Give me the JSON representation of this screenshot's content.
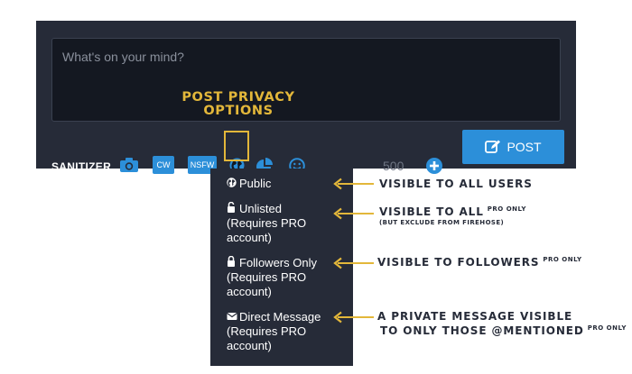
{
  "composer": {
    "placeholder": "What's on your mind?",
    "sanitizer_label": "SANITIZER",
    "tools": {
      "camera_icon": "camera-icon",
      "cw_label": "CW",
      "nsfw_label": "NSFW",
      "globe_icon": "globe-icon",
      "poll_icon": "pie-chart-icon",
      "emoji_icon": "smiley-icon"
    },
    "char_counter": "500",
    "add_icon": "plus-circle-icon",
    "post_label": "POST"
  },
  "annotation_title": [
    "POST PRIVACY",
    "OPTIONS"
  ],
  "privacy_menu": [
    {
      "icon": "globe-icon",
      "lines": [
        "Public"
      ]
    },
    {
      "icon": "unlock-icon",
      "lines": [
        "Unlisted",
        "(Requires PRO",
        "account)"
      ]
    },
    {
      "icon": "lock-icon",
      "lines": [
        "Followers Only",
        "(Requires PRO",
        "account)"
      ]
    },
    {
      "icon": "envelope-icon",
      "lines": [
        "Direct Message",
        "(Requires PRO",
        "account)"
      ]
    }
  ],
  "descriptions": {
    "public": "VISIBLE TO ALL USERS",
    "unlisted": "VISIBLE TO ALL",
    "unlisted_note": "PRO ONLY",
    "unlisted_sub": "(BUT EXCLUDE FROM FIREHOSE)",
    "followers": "VISIBLE TO FOLLOWERS",
    "followers_note": "PRO ONLY",
    "direct_line1": "A PRIVATE MESSAGE VISIBLE",
    "direct_line2": "TO ONLY THOSE @MENTIONED",
    "direct_note": "PRO ONLY"
  },
  "colors": {
    "panel": "#262b38",
    "field": "#141821",
    "accent_blue": "#2c8fd9",
    "annotation_gold": "#e3b73a"
  }
}
